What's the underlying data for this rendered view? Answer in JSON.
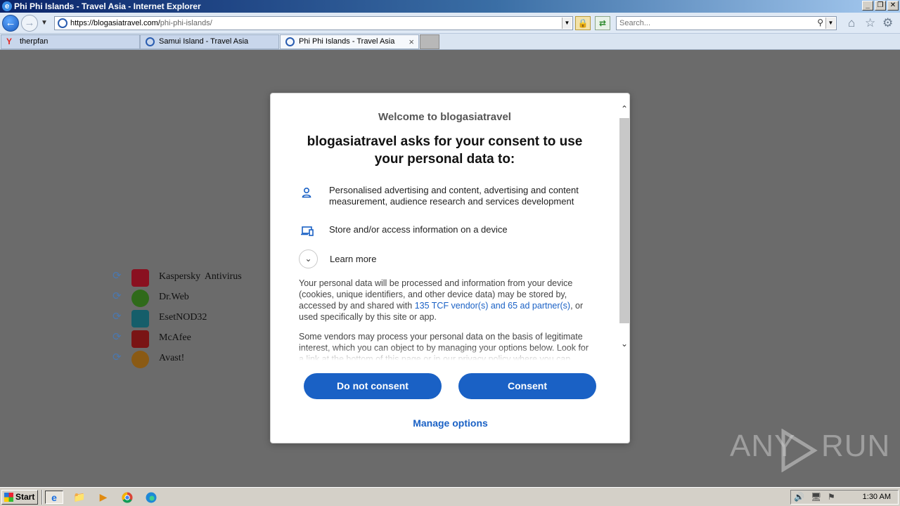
{
  "window": {
    "title": "Phi Phi Islands - Travel Asia - Internet Explorer",
    "buttons": {
      "minimize": "_",
      "restore": "❐",
      "close": "✕"
    }
  },
  "navigation": {
    "url_host": "https://blogasiatravel.com/",
    "url_path": "phi-phi-islands/",
    "search_placeholder": "Search..."
  },
  "tabs": [
    {
      "label": "therpfan",
      "icon": "yandex-icon",
      "active": false
    },
    {
      "label": "Samui Island - Travel Asia",
      "icon": "site-icon",
      "active": false
    },
    {
      "label": "Phi Phi Islands - Travel Asia",
      "icon": "site-icon",
      "active": true
    }
  ],
  "page_list": [
    {
      "label": "Kaspersky Antivirus",
      "icon": "kaspersky-icon",
      "color": "#c8102e"
    },
    {
      "label": "Dr.Web",
      "icon": "drweb-icon",
      "color": "#4e9a2a"
    },
    {
      "label": "EsetNOD32",
      "icon": "eset-icon",
      "color": "#1d8b9c"
    },
    {
      "label": "McAfee",
      "icon": "mcafee-icon",
      "color": "#b01a1a"
    },
    {
      "label": "Avast!",
      "icon": "avast-icon",
      "color": "#e07a12"
    }
  ],
  "consent": {
    "welcome": "Welcome to blogasiatravel",
    "headline": "blogasiatravel asks for your consent to use your personal data to:",
    "purposes": [
      {
        "icon": "person-icon",
        "text": "Personalised advertising and content, advertising and content measurement, audience research and services development"
      },
      {
        "icon": "device-icon",
        "text": "Store and/or access information on a device"
      }
    ],
    "learn_more": "Learn more",
    "para1_pre": "Your personal data will be processed and information from your device (cookies, unique identifiers, and other device data) may be stored by, accessed by and shared with ",
    "para1_link": "135 TCF vendor(s) and 65 ad partner(s)",
    "para1_post": ", or used specifically by this site or app.",
    "para2": "Some vendors may process your personal data on the basis of legitimate interest, which you can object to by managing your options below. Look for a link at the bottom of this page or in our privacy policy where you can",
    "do_not_consent": "Do not consent",
    "consent": "Consent",
    "manage_options": "Manage options",
    "accent_color": "#1a61c5"
  },
  "watermark": {
    "left": "ANY",
    "right": "RUN"
  },
  "taskbar": {
    "start": "Start",
    "clock": "1:30 AM"
  }
}
